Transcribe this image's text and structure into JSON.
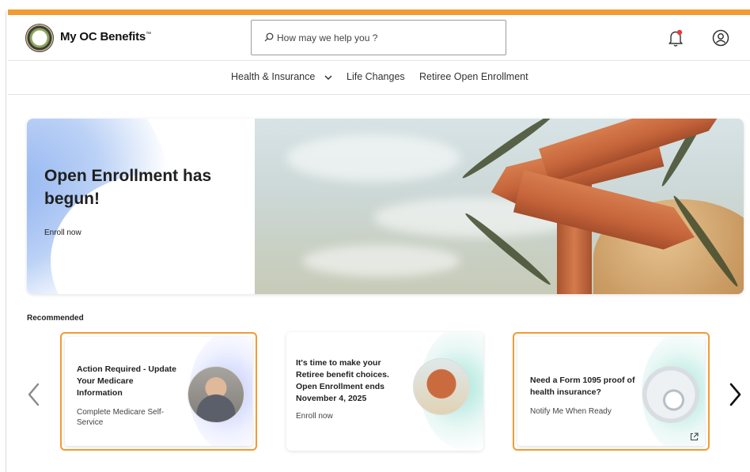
{
  "colors": {
    "accent": "#f39a33",
    "text": "#1e1e1e"
  },
  "header": {
    "brand": "My OC Benefits",
    "brand_mark": "™",
    "search_placeholder": "How may we help you ?"
  },
  "nav": {
    "items": [
      {
        "label": "Health & Insurance",
        "has_dropdown": true
      },
      {
        "label": "Life Changes"
      },
      {
        "label": "Retiree Open Enrollment"
      }
    ]
  },
  "hero": {
    "title": "Open Enrollment has begun!",
    "link": "Enroll now"
  },
  "recommended": {
    "label": "Recommended",
    "cards": [
      {
        "title": "Action Required - Update Your Medicare Information",
        "subtitle": "Complete Medicare Self-Service",
        "selected": true
      },
      {
        "title": "It's time to make your Retiree benefit choices. Open Enrollment ends November 4, 2025",
        "subtitle": "Enroll now",
        "selected": false
      },
      {
        "title": "Need a Form 1095 proof of health insurance?",
        "subtitle": "Notify Me When Ready",
        "selected": true
      }
    ]
  },
  "icons": {
    "search": "search-icon",
    "notifications": "bell-icon",
    "account": "account-icon",
    "prev": "chevron-left-icon",
    "next": "chevron-right-icon",
    "external": "external-link-icon"
  }
}
